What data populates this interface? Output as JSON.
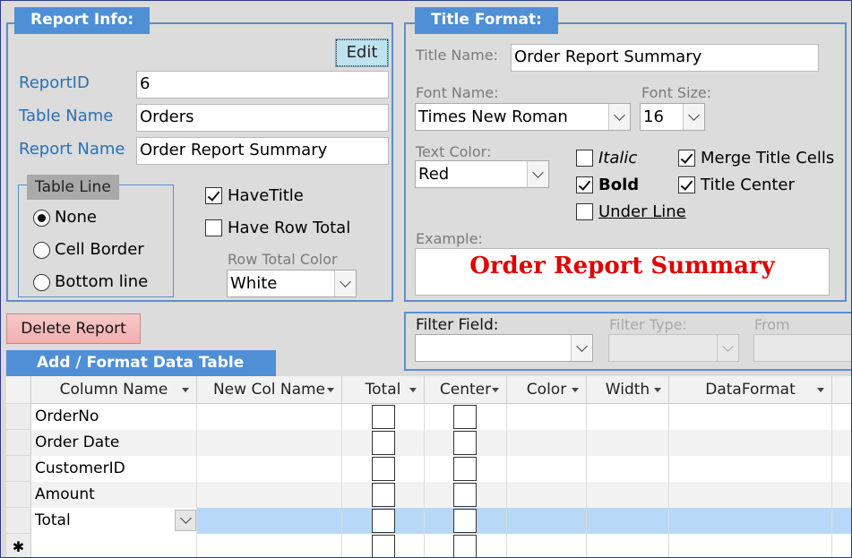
{
  "report_info": {
    "label": "Report Info:",
    "edit_button": "Edit",
    "report_id_label": "ReportID",
    "report_id_value": "6",
    "table_name_label": "Table Name",
    "table_name_value": "Orders",
    "report_name_label": "Report Name",
    "report_name_value": "Order Report Summary",
    "table_line": {
      "label": "Table Line",
      "options": [
        "None",
        "Cell Border",
        "Bottom line"
      ],
      "selected": "None"
    },
    "have_title_label": "HaveTitle",
    "have_title_checked": true,
    "have_row_total_label": "Have Row Total",
    "have_row_total_checked": false,
    "row_total_color_label": "Row Total Color",
    "row_total_color_value": "White"
  },
  "title_format": {
    "label": "Title Format:",
    "title_name_label": "Title Name:",
    "title_name_value": "Order Report Summary",
    "font_name_label": "Font Name:",
    "font_name_value": "Times New Roman",
    "font_size_label": "Font Size:",
    "font_size_value": "16",
    "text_color_label": "Text Color:",
    "text_color_value": "Red",
    "italic_label": "Italic",
    "bold_label": "Bold",
    "underline_label": "Under Line",
    "merge_label": "Merge Title Cells",
    "center_label": "Title Center",
    "italic_checked": false,
    "bold_checked": true,
    "underline_checked": false,
    "merge_checked": true,
    "center_checked": true,
    "example_label": "Example:",
    "example_text": "Order Report Summary",
    "example_color": "#e00000"
  },
  "delete_button": "Delete Report",
  "filter": {
    "field_label": "Filter Field:",
    "type_label": "Filter Type:",
    "from_label": "From",
    "field_value": ""
  },
  "data_table": {
    "label": "Add / Format  Data Table",
    "columns": [
      "Column Name",
      "New Col Name",
      "Total",
      "Center",
      "Color",
      "Width",
      "DataFormat"
    ],
    "rows": [
      {
        "name": "OrderNo",
        "new": "",
        "color": "",
        "width": "",
        "format": ""
      },
      {
        "name": "Order Date",
        "new": "",
        "color": "",
        "width": "",
        "format": ""
      },
      {
        "name": "CustomerID",
        "new": "",
        "color": "",
        "width": "",
        "format": ""
      },
      {
        "name": "Amount",
        "new": "",
        "color": "",
        "width": "",
        "format": ""
      },
      {
        "name": "Total",
        "new": "",
        "color": "",
        "width": "",
        "format": ""
      }
    ],
    "new_row_marker": "✱"
  }
}
